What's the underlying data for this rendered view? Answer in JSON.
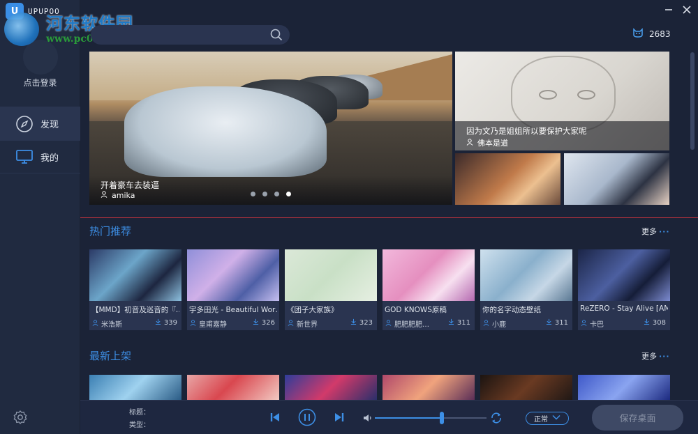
{
  "app": {
    "logo_text": "UPUPOO"
  },
  "watermark": {
    "name": "河东软件园",
    "url": "www.pc0359.cn"
  },
  "sidebar": {
    "login_label": "点击登录",
    "items": [
      {
        "label": "发现",
        "icon": "compass-icon",
        "active": true
      },
      {
        "label": "我的",
        "icon": "monitor-icon",
        "active": false
      }
    ]
  },
  "header": {
    "search_placeholder": "",
    "coins": "2683"
  },
  "banner": {
    "main": {
      "title": "开着豪车去装逼",
      "author": "amika",
      "active_slide": 4,
      "slides": 4
    },
    "side": {
      "title": "因为文乃是姐姐所以要保护大家呢",
      "author": "佛本是道"
    }
  },
  "hot": {
    "title": "热门推荐",
    "more": "更多",
    "cards": [
      {
        "title": "【MMD】初音及巡音的『…",
        "author": "米浩斯",
        "downloads": "339"
      },
      {
        "title": "宇多田光 - Beautiful Wor…",
        "author": "皇甫嘉静",
        "downloads": "326"
      },
      {
        "title": "《团子大家族》",
        "author": "新世界",
        "downloads": "323"
      },
      {
        "title": "GOD KNOWS原稿",
        "author": "肥肥肥肥…",
        "downloads": "311"
      },
      {
        "title": "你的名字动态壁纸",
        "author": "小鹿",
        "downloads": "311"
      },
      {
        "title": "ReZERO - Stay Alive [AM…",
        "author": "卡巴",
        "downloads": "308"
      }
    ]
  },
  "latest": {
    "title": "最新上架",
    "more": "更多"
  },
  "player": {
    "title_label": "标题：",
    "type_label": "类型：",
    "volume": 0.6,
    "mode": "正常",
    "save_label": "保存桌面"
  },
  "colors": {
    "accent": "#3d8fe6",
    "divider": "#b0313d",
    "background": "#1b2337"
  }
}
